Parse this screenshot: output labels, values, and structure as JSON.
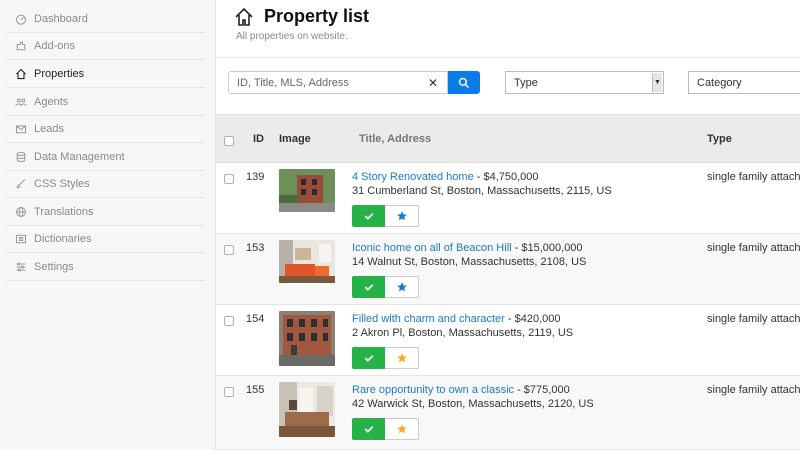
{
  "sidebar": {
    "items": [
      {
        "label": "Dashboard",
        "icon": "dashboard-icon",
        "active": false
      },
      {
        "label": "Add-ons",
        "icon": "addons-icon",
        "active": false
      },
      {
        "label": "Properties",
        "icon": "home-icon",
        "active": true
      },
      {
        "label": "Agents",
        "icon": "agents-icon",
        "active": false
      },
      {
        "label": "Leads",
        "icon": "envelope-icon",
        "active": false
      },
      {
        "label": "Data Management",
        "icon": "database-icon",
        "active": false
      },
      {
        "label": "CSS Styles",
        "icon": "brush-icon",
        "active": false
      },
      {
        "label": "Translations",
        "icon": "globe-icon",
        "active": false
      },
      {
        "label": "Dictionaries",
        "icon": "list-icon",
        "active": false
      },
      {
        "label": "Settings",
        "icon": "sliders-icon",
        "active": false
      }
    ]
  },
  "header": {
    "title": "Property list",
    "subtitle": "All properties on website."
  },
  "filters": {
    "search_placeholder": "ID, Title, MLS, Address",
    "clear_label": "✕",
    "type_select": "Type",
    "category_select": "Category"
  },
  "table": {
    "columns": {
      "id": "ID",
      "image": "Image",
      "title": "Title, Address",
      "type": "Type"
    },
    "rows": [
      {
        "id": "139",
        "title": "4 Story Renovated home",
        "price": " - $4,750,000",
        "address": "31 Cumberland St, Boston, Massachusetts, 2115, US",
        "type": "single family attache",
        "featured": false
      },
      {
        "id": "153",
        "title": "Iconic home on all of Beacon Hill",
        "price": " - $15,000,000",
        "address": "14 Walnut St, Boston, Massachusetts, 2108, US",
        "type": "single family attache",
        "featured": false
      },
      {
        "id": "154",
        "title": "Filled with charm and character",
        "price": " - $420,000",
        "address": "2 Akron Pl, Boston, Massachusetts, 2119, US",
        "type": "single family attache",
        "featured": true
      },
      {
        "id": "155",
        "title": "Rare opportunity to own a classic",
        "price": " - $775,000",
        "address": "42 Warwick St, Boston, Massachusetts, 2120, US",
        "type": "single family attache",
        "featured": true
      }
    ]
  },
  "colors": {
    "accent": "#0a7ce8",
    "link": "#1a7bc9",
    "approve": "#25b347",
    "star_blue": "#1a7bc9",
    "star_gold": "#f0ad2c"
  }
}
